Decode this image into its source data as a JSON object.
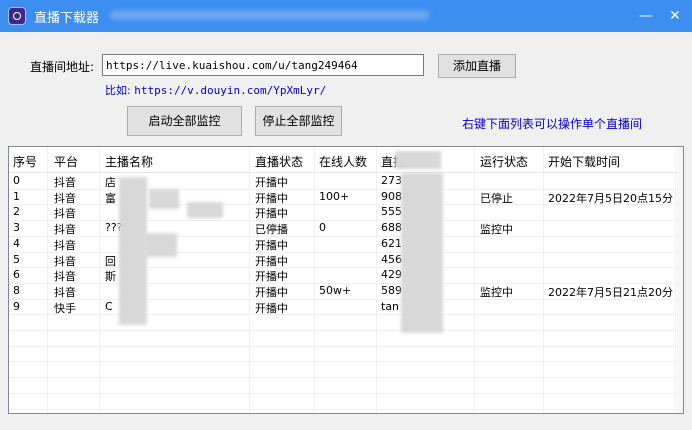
{
  "window": {
    "title": "直播下载器",
    "minimize_symbol": "—",
    "close_symbol": "✕"
  },
  "form": {
    "address_label": "直播间地址:",
    "address_value": "https://live.kuaishou.com/u/tang249464",
    "add_button": "添加直播",
    "example_prefix": "比如: ",
    "example_url": "https://v.douyin.com/YpXmLyr/",
    "start_all_button": "启动全部监控",
    "stop_all_button": "停止全部监控",
    "right_click_hint": "右键下面列表可以操作单个直播间"
  },
  "table": {
    "headers": [
      "序号",
      "平台",
      "主播名称",
      "直播状态",
      "在线人数",
      "直播",
      "运行状态",
      "开始下载时间"
    ],
    "rows": [
      [
        "0",
        "抖音",
        "店",
        "开播中",
        "",
        "273",
        "",
        ""
      ],
      [
        "1",
        "抖音",
        "富",
        "开播中",
        "100+",
        "908",
        "已停止",
        "2022年7月5日20点15分"
      ],
      [
        "2",
        "抖音",
        "",
        "开播中",
        "",
        "555",
        "",
        ""
      ],
      [
        "3",
        "抖音",
        "?????",
        "已停播",
        "0",
        "688",
        "监控中",
        ""
      ],
      [
        "4",
        "抖音",
        "",
        "开播中",
        "",
        "621",
        "",
        ""
      ],
      [
        "5",
        "抖音",
        "回",
        "开播中",
        "",
        "456",
        "",
        ""
      ],
      [
        "6",
        "抖音",
        "斯",
        "开播中",
        "",
        "429",
        "",
        ""
      ],
      [
        "8",
        "抖音",
        "",
        "开播中",
        "50w+",
        "589",
        "监控中",
        "2022年7月5日21点20分"
      ],
      [
        "9",
        "快手",
        "C",
        "开播中",
        "",
        "tan",
        "",
        ""
      ]
    ]
  }
}
